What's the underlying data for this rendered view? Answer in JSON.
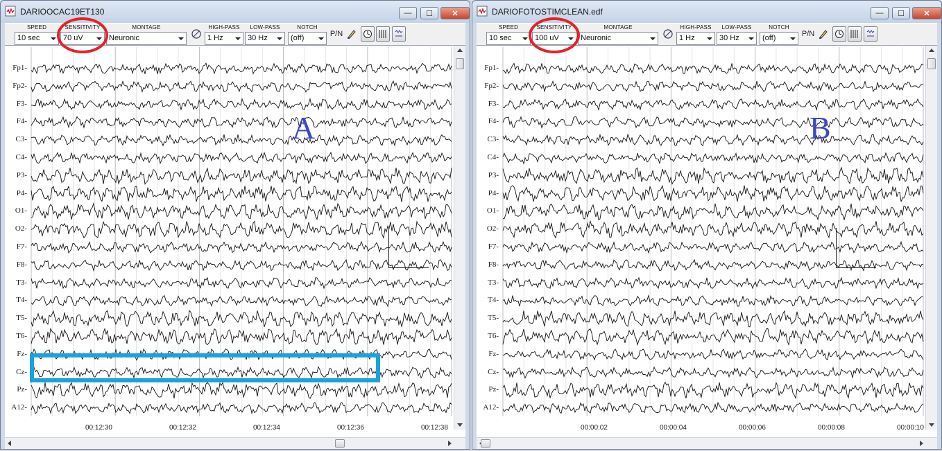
{
  "windows": [
    {
      "id": "a",
      "title": "DARIOOCAC19ET130",
      "toolbar": {
        "speed": {
          "label": "SPEED",
          "value": "10 sec"
        },
        "sensitivity": {
          "label": "SENSITIVITY",
          "value": "70 uV"
        },
        "montage": {
          "label": "MONTAGE",
          "value": "Neuronic"
        },
        "high_pass": {
          "label": "HIGH-PASS",
          "value": "1 Hz"
        },
        "low_pass": {
          "label": "LOW-PASS",
          "value": "30 Hz"
        },
        "notch": {
          "label": "NOTCH",
          "value": "(off)"
        },
        "polarity_label": "P/N"
      },
      "channels": [
        "Fp1",
        "Fp2",
        "F3",
        "F4",
        "C3",
        "C4",
        "P3",
        "P4",
        "O1",
        "O2",
        "F7",
        "F8",
        "T3",
        "T4",
        "T5",
        "T6",
        "Fz",
        "Cz",
        "Pz",
        "A12"
      ],
      "time_labels": [
        "00:12:30",
        "00:12:32",
        "00:12:34",
        "00:12:36",
        "00:12:38"
      ],
      "annotation_letter": "A"
    },
    {
      "id": "b",
      "title": "DARIOFOTOSTIMCLEAN.edf",
      "toolbar": {
        "speed": {
          "label": "SPEED",
          "value": "10 sec"
        },
        "sensitivity": {
          "label": "SENSITIVITY",
          "value": "100 uV"
        },
        "montage": {
          "label": "MONTAGE",
          "value": "Neuronic"
        },
        "high_pass": {
          "label": "HIGH-PASS",
          "value": "1 Hz"
        },
        "low_pass": {
          "label": "LOW-PASS",
          "value": "30 Hz"
        },
        "notch": {
          "label": "NOTCH",
          "value": "(off)"
        },
        "polarity_label": "P/N"
      },
      "channels": [
        "Fp1",
        "Fp2",
        "F3",
        "F4",
        "C3",
        "C4",
        "P3",
        "P4",
        "O1",
        "O2",
        "F7",
        "F8",
        "T3",
        "T4",
        "T5",
        "T6",
        "Fz",
        "Cz",
        "Pz",
        "A12"
      ],
      "time_labels": [
        "00:00:02",
        "00:00:04",
        "00:00:06",
        "00:00:08",
        "00:00:10"
      ],
      "annotation_letter": "B"
    }
  ],
  "window_controls": {
    "minimize": "—",
    "maximize": "☐",
    "close": "✕"
  },
  "colors": {
    "annotation_circle": "#e3222b",
    "annotation_box": "#1aa2dc",
    "annotation_letter": "#3b46c9"
  }
}
